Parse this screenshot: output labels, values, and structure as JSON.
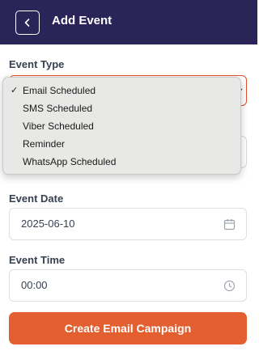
{
  "header": {
    "title": "Add Event",
    "back_icon": "chevron-left-icon",
    "background": "#2a2458"
  },
  "event_type": {
    "label": "Event Type",
    "selected": "Email Scheduled",
    "options": [
      "Email Scheduled",
      "SMS Scheduled",
      "Viber Scheduled",
      "Reminder",
      "WhatsApp Scheduled"
    ],
    "accent": "#e0502e"
  },
  "event_date": {
    "label": "Event Date",
    "value": "2025-06-10",
    "icon": "calendar-icon"
  },
  "event_time": {
    "label": "Event Time",
    "value": "00:00",
    "icon": "clock-icon"
  },
  "submit": {
    "label": "Create Email Campaign",
    "color": "#e35f2f"
  }
}
